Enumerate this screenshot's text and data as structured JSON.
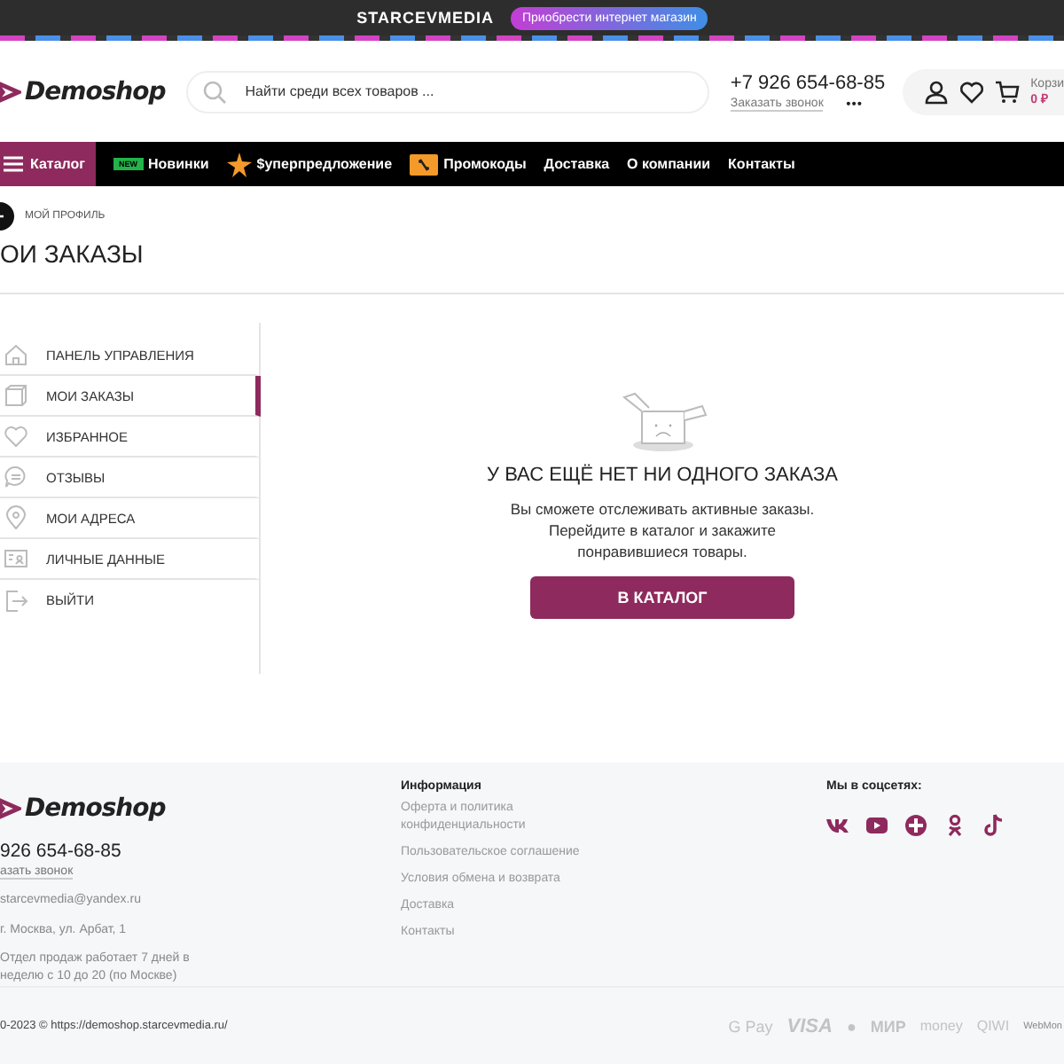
{
  "promo_bar": {
    "brand": "STARCEVMEDIA",
    "button": "Приобрести интернет магазин"
  },
  "header": {
    "logo": "Demoshop",
    "search": {
      "placeholder": "Найти среди всех товаров ..."
    },
    "phone": "+7 926 654-68-85",
    "callback": "Заказать звонок",
    "more": "•••",
    "cart": {
      "label": "Корзи",
      "total": "0 ₽"
    }
  },
  "nav": [
    {
      "kind": "catalog",
      "label": "Каталог"
    },
    {
      "kind": "new",
      "badge": "NEW",
      "label": "Новинки"
    },
    {
      "kind": "star",
      "label": "$уперпредложение"
    },
    {
      "kind": "promo",
      "label": "Промокоды"
    },
    {
      "kind": "plain",
      "label": "Доставка"
    },
    {
      "kind": "plain",
      "label": "О компании"
    },
    {
      "kind": "plain",
      "label": "Контакты"
    }
  ],
  "breadcrumb": "МОЙ ПРОФИЛЬ",
  "page_title": "ОИ ЗАКАЗЫ",
  "sidebar": {
    "items": [
      {
        "label": "ПАНЕЛЬ УПРАВЛЕНИЯ",
        "selected": false
      },
      {
        "label": "МОИ ЗАКАЗЫ",
        "selected": true
      },
      {
        "label": "ИЗБРАННОЕ",
        "selected": false
      },
      {
        "label": "ОТЗЫВЫ",
        "selected": false
      },
      {
        "label": "МОИ АДРЕСА",
        "selected": false
      },
      {
        "label": "ЛИЧНЫЕ ДАННЫЕ",
        "selected": false
      },
      {
        "label": "ВЫЙТИ",
        "selected": false
      }
    ]
  },
  "empty_state": {
    "title": "У ВАС ЕЩЁ НЕТ НИ ОДНОГО ЗАКАЗА",
    "text": "Вы сможете отслеживать активные заказы. Перейдите в каталог и закажите понравившиеся товары.",
    "button": "В КАТАЛОГ"
  },
  "footer": {
    "logo": "Demoshop",
    "phone": "926 654-68-85",
    "callback": "азать звонок",
    "contacts": [
      "starcevmedia@yandex.ru",
      "г. Москва, ул. Арбат, 1",
      "Отдел продаж работает 7 дней в неделю с 10 до 20 (по Москве)"
    ],
    "info": {
      "title": "Информация",
      "links": [
        "Оферта и политика конфиденциальности",
        "Пользовательское соглашение",
        "Условия обмена и возврата",
        "Доставка",
        "Контакты"
      ]
    },
    "social": {
      "title": "Мы в соцсетях:"
    },
    "copyright": "0-2023 © https://demoshop.starcevmedia.ru/",
    "payments": [
      "G Pay",
      "VISA",
      "●",
      "МИР",
      "money",
      "QIWI",
      "WebMon"
    ]
  }
}
